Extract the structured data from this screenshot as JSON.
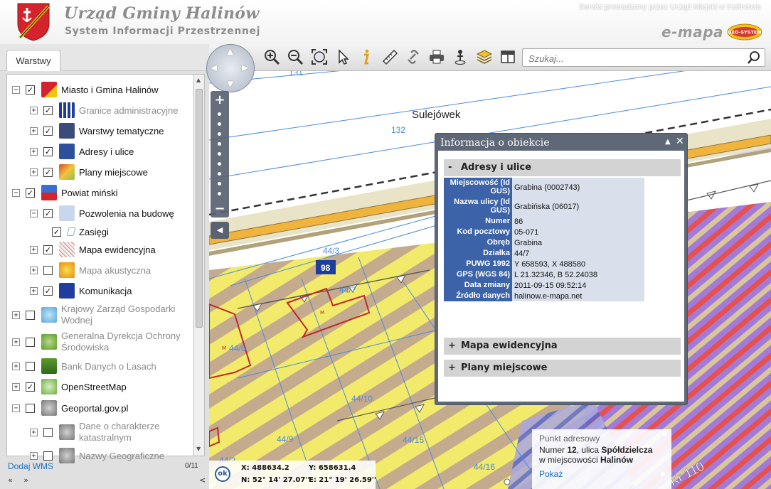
{
  "header": {
    "title": "Urząd Gminy Halinów",
    "subtitle": "System Informacji Przestrzennej",
    "operator": "Serwis prowadzony przez Urząd Miejski w Halinowie",
    "brand": "e-mapa",
    "partner_logo": "GEO-SYSTEM"
  },
  "tabs": {
    "layers": "Warstwy"
  },
  "tree": [
    {
      "label": "Miasto i Gmina Halinów",
      "level": 0,
      "expander": "−",
      "checked": true,
      "icon": "halinow-crest-icon",
      "dim": false
    },
    {
      "label": "Granice administracyjne",
      "level": 1,
      "expander": "+",
      "checked": true,
      "icon": "boundary-icon",
      "dim": true
    },
    {
      "label": "Warstwy tematyczne",
      "level": 1,
      "expander": "+",
      "checked": true,
      "icon": "layers-icon",
      "dim": false
    },
    {
      "label": "Adresy i ulice",
      "level": 1,
      "expander": "+",
      "checked": true,
      "icon": "envelope-icon",
      "dim": false
    },
    {
      "label": "Plany miejscowe",
      "level": 1,
      "expander": "+",
      "checked": true,
      "icon": "plan-icon",
      "dim": false
    },
    {
      "label": "Powiat miński",
      "level": 0,
      "expander": "−",
      "checked": true,
      "icon": "county-crest-icon",
      "dim": false
    },
    {
      "label": "Pozwolenia na budowę",
      "level": 1,
      "expander": "−",
      "checked": true,
      "icon": "permit-icon",
      "dim": false
    },
    {
      "label": "Zasięgi",
      "level": 2,
      "expander": "",
      "checked": true,
      "icon": "range-icon",
      "dim": false
    },
    {
      "label": "Mapa ewidencyjna",
      "level": 1,
      "expander": "+",
      "checked": true,
      "icon": "cadastral-icon",
      "dim": false
    },
    {
      "label": "Mapa akustyczna",
      "level": 1,
      "expander": "+",
      "checked": false,
      "icon": "acoustic-icon",
      "dim": true
    },
    {
      "label": "Komunikacja",
      "level": 1,
      "expander": "+",
      "checked": true,
      "icon": "bus-icon",
      "dim": false
    },
    {
      "label": "Krajowy Zarząd Gospodarki Wodnej",
      "level": 0,
      "expander": "+",
      "checked": false,
      "icon": "water-icon",
      "dim": true
    },
    {
      "label": "Generalna Dyrekcja Ochrony Środowiska",
      "level": 0,
      "expander": "+",
      "checked": false,
      "icon": "leaf-icon",
      "dim": true
    },
    {
      "label": "Bank Danych o Lasach",
      "level": 0,
      "expander": "+",
      "checked": false,
      "icon": "forest-icon",
      "dim": true
    },
    {
      "label": "OpenStreetMap",
      "level": 0,
      "expander": "+",
      "checked": true,
      "icon": "osm-icon",
      "dim": false
    },
    {
      "label": "Geoportal.gov.pl",
      "level": 0,
      "expander": "−",
      "checked": false,
      "icon": "geoportal-icon",
      "dim": false
    },
    {
      "label": "Dane o charakterze katastralnym",
      "level": 1,
      "expander": "+",
      "checked": false,
      "icon": "geoportal-icon",
      "dim": true
    },
    {
      "label": "Nazwy Geograficzne",
      "level": 1,
      "expander": "+",
      "checked": false,
      "icon": "geoportal-icon",
      "dim": true
    }
  ],
  "panel_footer": {
    "add_wms": "Dodaj WMS",
    "count": "0/11",
    "first": "«",
    "next": "»",
    "collapse": "<"
  },
  "search": {
    "placeholder": "Szukaj..."
  },
  "map": {
    "place_name": "Sulejówek",
    "parcel_labels": [
      "131",
      "132",
      "44/3",
      "44/7",
      "44/6",
      "44/10",
      "44/9",
      "44/15",
      "44/16",
      "44/2"
    ],
    "road_badge": "98",
    "road_label": "Kr 110",
    "building_mark": "M"
  },
  "info": {
    "title": "Informacja o obiekcie",
    "sections": {
      "addresses": "Adresy i ulice",
      "cadastral": "Mapa ewidencyjna",
      "plans": "Plany miejscowe"
    },
    "signs": {
      "open": "-",
      "closed": "+"
    },
    "attributes": [
      {
        "key": "Miejscowość (Id GUS)",
        "value": "Grabina (0002743)"
      },
      {
        "key": "Nazwa ulicy (Id GUS)",
        "value": "Grabińska (06017)"
      },
      {
        "key": "Numer",
        "value": "86"
      },
      {
        "key": "Kod pocztowy",
        "value": "05-071"
      },
      {
        "key": "Obręb",
        "value": "Grabina"
      },
      {
        "key": "Działka",
        "value": "44/7"
      },
      {
        "key": "PUWG 1992",
        "value": "Y 658593, X 488580"
      },
      {
        "key": "GPS (WGS 84)",
        "value": "L 21.32346, B 52.24038"
      },
      {
        "key": "Data zmiany",
        "value": "2011-09-15 09:52:14"
      },
      {
        "key": "Źródło danych",
        "value": "halinow.e-mapa.net"
      }
    ]
  },
  "status": {
    "ok": "ok",
    "x": "X: 488634.2",
    "y": "Y: 658631.4",
    "n": "N: 52° 14' 27.07''",
    "e": "E: 21° 19' 26.59''"
  },
  "address_point": {
    "label": "Punkt adresowy",
    "number_prefix": "Numer",
    "number": "12",
    "street_prefix": ", ulica",
    "street": "Spółdzielcza",
    "town_prefix": "w miejscowości",
    "town": "Halinów",
    "link": "Pokaż"
  },
  "colors": {
    "panel_blue": "#3c63a8",
    "hatch_yellow": "#f2ea6a",
    "hatch_brown": "#c4ab8e",
    "hatch_purple": "#a27bd8",
    "hatch_red": "#e8504e",
    "road": "#f0b43c",
    "link": "#1a6fc0"
  }
}
